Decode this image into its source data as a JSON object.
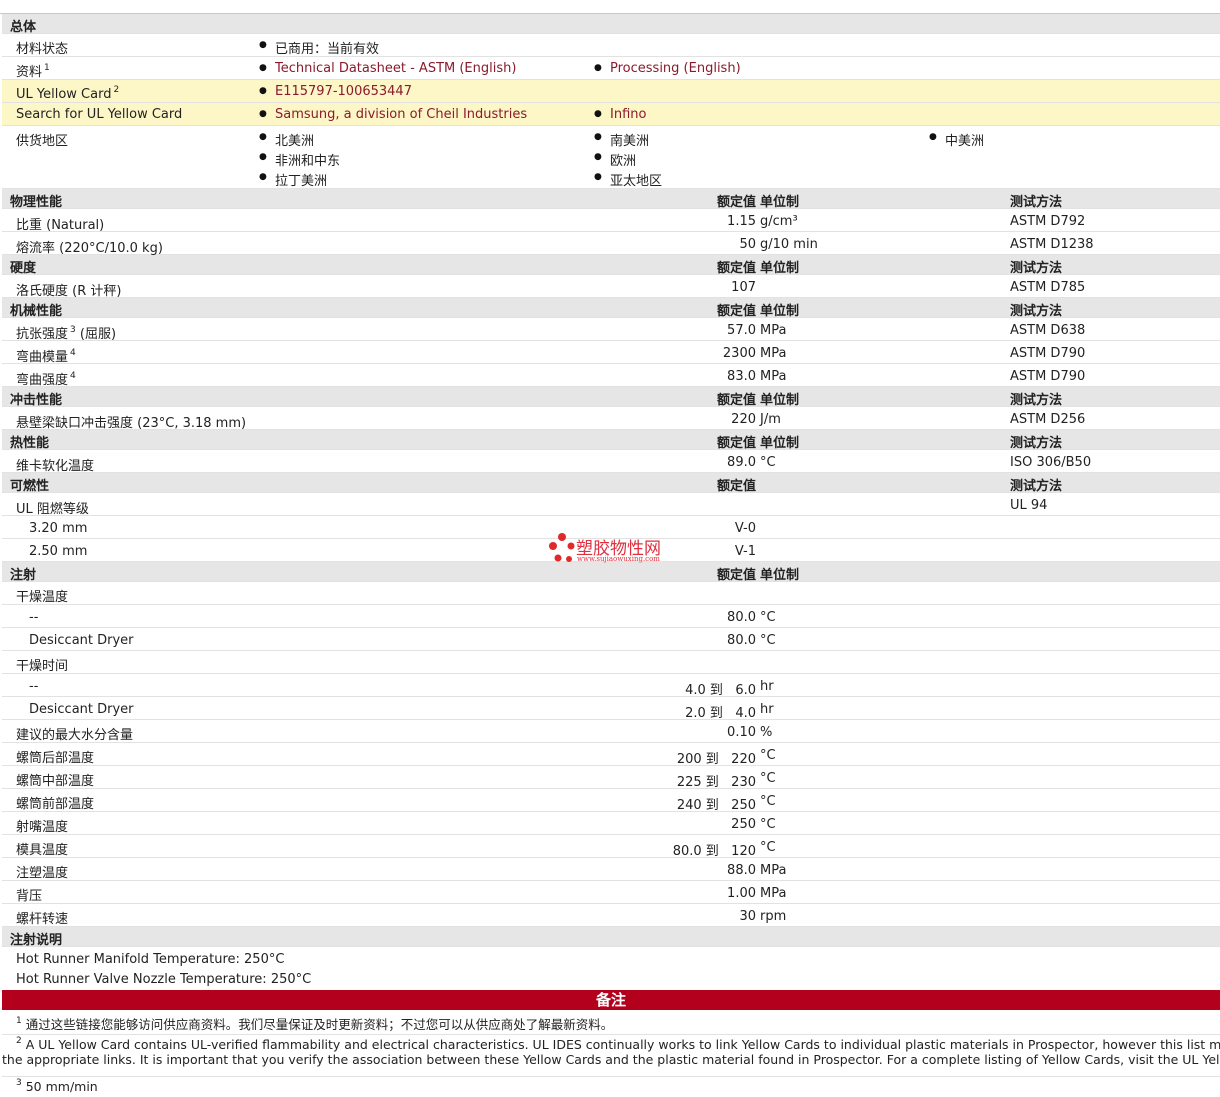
{
  "general": {
    "title": "总体",
    "status_label": "材料状态",
    "status_value": "已商用：当前有效",
    "docs_label": "资料",
    "docs_sup": "1",
    "doc_link_1": "Technical Datasheet - ASTM (English)",
    "doc_link_2": "Processing (English)",
    "ul_label": "UL Yellow Card",
    "ul_sup": "2",
    "ul_value": "E115797-100653447",
    "search_label": "Search for UL Yellow Card",
    "search_link_1": "Samsung, a division of Cheil Industries",
    "search_link_2": "Infino",
    "supply_label": "供货地区",
    "regions": [
      "北美洲",
      "南美洲",
      "中美洲",
      "非洲和中东",
      "欧洲",
      "拉丁美洲",
      "亚太地区"
    ]
  },
  "headers": {
    "rated": "额定值",
    "unit": "单位制",
    "test": "测试方法"
  },
  "physical": {
    "title": "物理性能",
    "rows": [
      {
        "label": "比重  (Natural)",
        "value": "1.15",
        "unit": "g/cm³",
        "test": "ASTM D792"
      },
      {
        "label": "熔流率  (220°C/10.0 kg)",
        "value": "50",
        "unit": "g/10 min",
        "test": "ASTM D1238"
      }
    ]
  },
  "hardness": {
    "title": "硬度",
    "rows": [
      {
        "label": "洛氏硬度  (R 计秤)",
        "value": "107",
        "unit": "",
        "test": "ASTM D785"
      }
    ]
  },
  "mechanical": {
    "title": "机械性能",
    "rows": [
      {
        "label": "抗张强度",
        "sup": "3",
        "suffix": " (屈服)",
        "value": "57.0",
        "unit": "MPa",
        "test": "ASTM D638"
      },
      {
        "label": "弯曲模量",
        "sup": "4",
        "suffix": "",
        "value": "2300",
        "unit": "MPa",
        "test": "ASTM D790"
      },
      {
        "label": "弯曲强度",
        "sup": "4",
        "suffix": "",
        "value": "83.0",
        "unit": "MPa",
        "test": "ASTM D790"
      }
    ]
  },
  "impact": {
    "title": "冲击性能",
    "rows": [
      {
        "label": "悬壁梁缺口冲击强度  (23°C, 3.18 mm)",
        "value": "220",
        "unit": "J/m",
        "test": "ASTM D256"
      }
    ]
  },
  "thermal": {
    "title": "热性能",
    "rows": [
      {
        "label": "维卡软化温度",
        "value": "89.0",
        "unit": "°C",
        "test": "ISO 306/B50"
      }
    ]
  },
  "flammability": {
    "title": "可燃性",
    "label": "UL 阻燃等级",
    "test": "UL 94",
    "rows": [
      {
        "label": "3.20 mm",
        "value": "V-0"
      },
      {
        "label": "2.50 mm",
        "value": "V-1"
      }
    ]
  },
  "injection": {
    "title": "注射",
    "drying_temp": "干燥温度",
    "drying_time": "干燥时间",
    "rows": [
      {
        "label": "--",
        "value": "80.0",
        "unit": "°C"
      },
      {
        "label": "Desiccant Dryer",
        "value": "80.0",
        "unit": "°C"
      },
      {
        "label": "--",
        "value": "4.0 到   6.0",
        "unit": "hr"
      },
      {
        "label": "Desiccant Dryer",
        "value": "2.0 到   4.0",
        "unit": "hr"
      },
      {
        "label": "建议的最大水分含量",
        "value": "0.10",
        "unit": "%"
      },
      {
        "label": "螺筒后部温度",
        "value": "200 到   220",
        "unit": "°C"
      },
      {
        "label": "螺筒中部温度",
        "value": "225 到   230",
        "unit": "°C"
      },
      {
        "label": "螺筒前部温度",
        "value": "240 到   250",
        "unit": "°C"
      },
      {
        "label": "射嘴温度",
        "value": "250",
        "unit": "°C"
      },
      {
        "label": "模具温度",
        "value": "80.0 到   120",
        "unit": "°C"
      },
      {
        "label": "注塑温度",
        "value": "88.0",
        "unit": "MPa"
      },
      {
        "label": "背压",
        "value": "1.00",
        "unit": "MPa"
      },
      {
        "label": "螺杆转速",
        "value": "30",
        "unit": "rpm"
      }
    ]
  },
  "injection_notes": {
    "title": "注射说明",
    "line1": "Hot Runner Manifold Temperature: 250°C",
    "line2": "Hot Runner Valve Nozzle Temperature: 250°C"
  },
  "notes": {
    "title": "备注",
    "n1_sup": "1",
    "n1": "通过这些链接您能够访问供应商资料。我们尽量保证及时更新资料；不过您可以从供应商处了解最新资料。",
    "n2_sup": "2",
    "n2a": "A UL Yellow Card contains UL-verified flammability and electrical characteristics. UL IDES continually works to link Yellow Cards to individual plastic materials in Prospector, however this list may not include all of",
    "n2b": "the appropriate links. It is important that you verify the association between these Yellow Cards and the plastic material found in Prospector. For a complete listing of Yellow Cards, visit the UL Yellow Card Search.",
    "n3_sup": "3",
    "n3": "50 mm/min"
  },
  "watermark": {
    "cn": "塑胶物性网",
    "en": "www.sujiaowuxing.com"
  },
  "colors": {
    "header_bg": "#e6e6e6",
    "yellow_bg": "#fdf7c8",
    "link": "#8b1a2b",
    "notes_bar": "#b3001c"
  }
}
